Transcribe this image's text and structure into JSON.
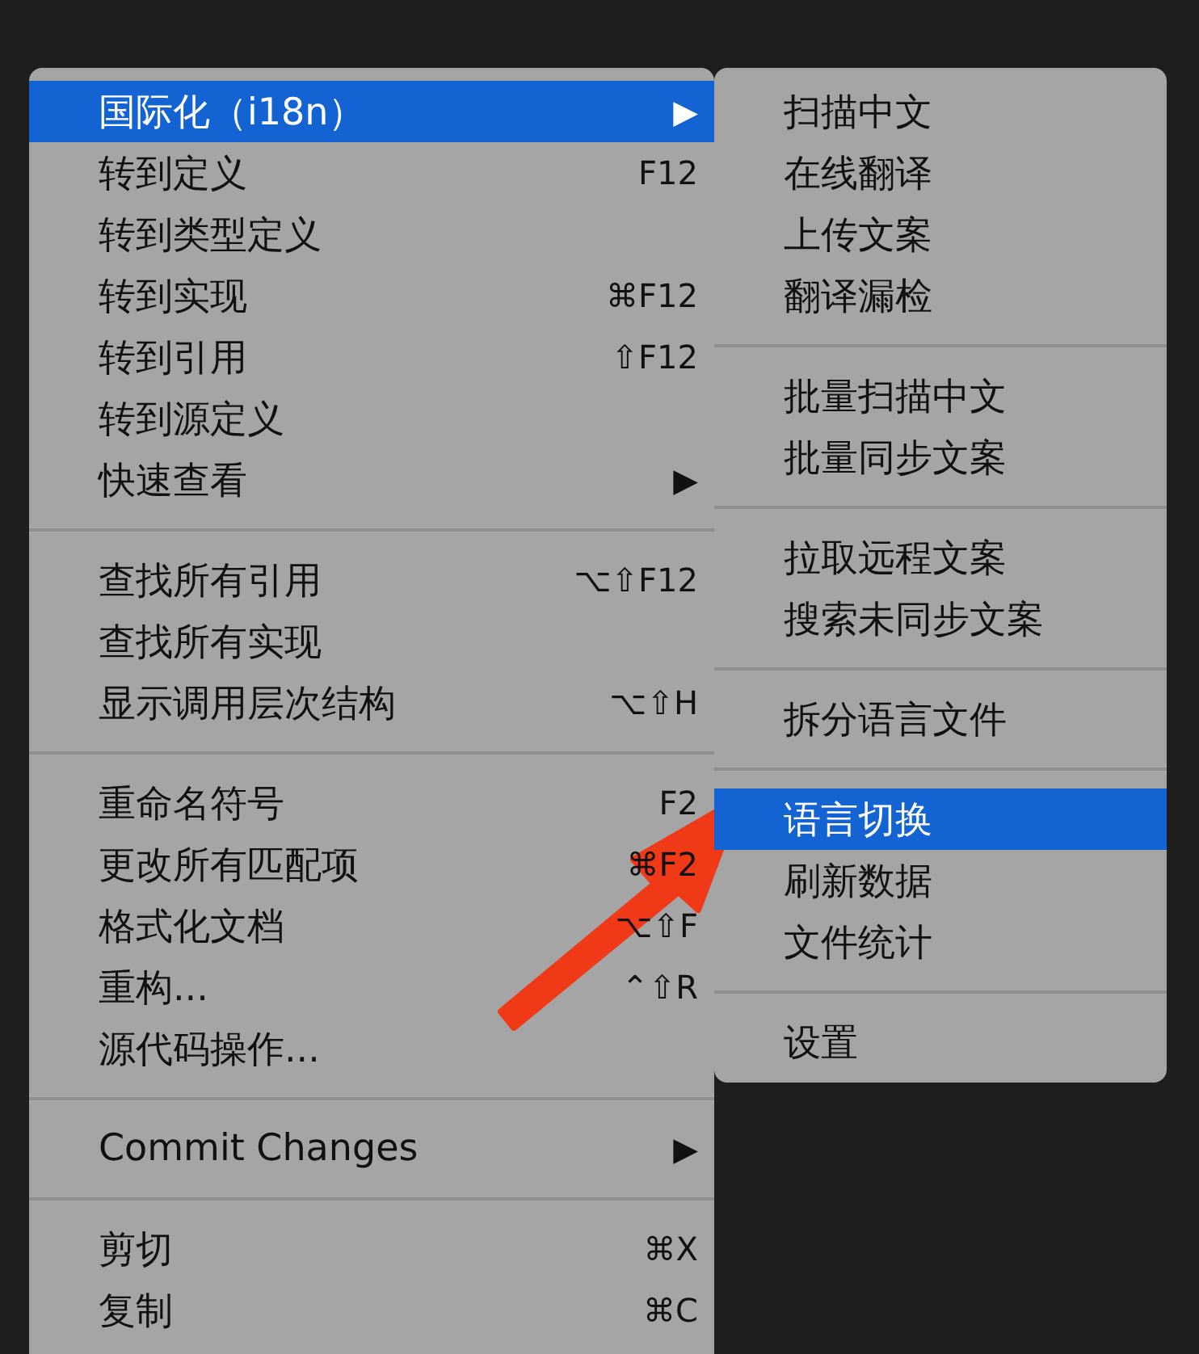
{
  "context_menu": {
    "groups": [
      {
        "items": [
          {
            "label": "国际化（i18n）",
            "shortcut": "▶",
            "selected": true
          },
          {
            "label": "转到定义",
            "shortcut": "F12",
            "selected": false
          },
          {
            "label": "转到类型定义",
            "selected": false
          },
          {
            "label": "转到实现",
            "shortcut": "⌘F12",
            "selected": false
          },
          {
            "label": "转到引用",
            "shortcut": "⇧F12",
            "selected": false
          },
          {
            "label": "转到源定义",
            "selected": false
          },
          {
            "label": "快速查看",
            "shortcut": "▶",
            "selected": false
          }
        ]
      },
      {
        "items": [
          {
            "label": "查找所有引用",
            "shortcut": "⌥⇧F12",
            "selected": false
          },
          {
            "label": "查找所有实现",
            "selected": false
          },
          {
            "label": "显示调用层次结构",
            "shortcut": "⌥⇧H",
            "selected": false
          }
        ]
      },
      {
        "items": [
          {
            "label": "重命名符号",
            "shortcut": "F2",
            "selected": false
          },
          {
            "label": "更改所有匹配项",
            "shortcut": "⌘F2",
            "selected": false
          },
          {
            "label": "格式化文档",
            "shortcut": "⌥⇧F",
            "selected": false
          },
          {
            "label": "重构...",
            "shortcut": "⌃⇧R",
            "selected": false
          },
          {
            "label": "源代码操作...",
            "selected": false
          }
        ]
      },
      {
        "items": [
          {
            "label": "Commit Changes",
            "shortcut": "▶",
            "selected": false
          }
        ]
      },
      {
        "items": [
          {
            "label": "剪切",
            "shortcut": "⌘X",
            "selected": false
          },
          {
            "label": "复制",
            "shortcut": "⌘C",
            "selected": false
          }
        ]
      }
    ]
  },
  "submenu": {
    "groups": [
      {
        "items": [
          {
            "label": "扫描中文",
            "selected": false
          },
          {
            "label": "在线翻译",
            "selected": false
          },
          {
            "label": "上传文案",
            "selected": false
          },
          {
            "label": "翻译漏检",
            "selected": false
          }
        ]
      },
      {
        "items": [
          {
            "label": "批量扫描中文",
            "selected": false
          },
          {
            "label": "批量同步文案",
            "selected": false
          }
        ]
      },
      {
        "items": [
          {
            "label": "拉取远程文案",
            "selected": false
          },
          {
            "label": "搜索未同步文案",
            "selected": false
          }
        ]
      },
      {
        "items": [
          {
            "label": "拆分语言文件",
            "selected": false
          }
        ]
      },
      {
        "items": [
          {
            "label": "语言切换",
            "selected": true
          },
          {
            "label": "刷新数据",
            "selected": false
          },
          {
            "label": "文件统计",
            "selected": false
          }
        ]
      },
      {
        "items": [
          {
            "label": "设置",
            "selected": false
          }
        ]
      }
    ]
  }
}
